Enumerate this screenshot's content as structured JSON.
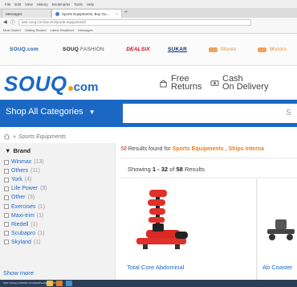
{
  "browser": {
    "menu": [
      "File",
      "Edit",
      "View",
      "History",
      "Bookmarks",
      "Tools",
      "Help"
    ],
    "tabs": [
      {
        "label": "Messages"
      },
      {
        "label": "Sports Equipments, Buy Gu..."
      }
    ],
    "new_tab": "+",
    "url": "uae.souq.com/ae-en/sports-equipments/",
    "bookmarks": [
      "Most Visited",
      "Getting Started",
      "Latest Headlines",
      "Messages"
    ]
  },
  "brand_strip": {
    "souq": "SOUQ.com",
    "fashion_bold": "SOUQ",
    "fashion_thin": "FASHION",
    "deal": "DEALSIX",
    "sukar": "SUKAR",
    "stores": "Stores",
    "motors": "Motors"
  },
  "header": {
    "logo_word": "SOUQ",
    "logo_com": "com",
    "perks": [
      {
        "line1": "Free",
        "line2": "Returns",
        "icon": "return-box-icon"
      },
      {
        "line1": "Cash",
        "line2": "On Delivery",
        "icon": "cash-icon"
      }
    ]
  },
  "search": {
    "category_label": "Shop All Categories",
    "placeholder": "",
    "clip": "S"
  },
  "breadcrumb": {
    "separator": "»",
    "current": "Sports Equipments"
  },
  "sidebar": {
    "heading": "Brand",
    "filters": [
      {
        "label": "Winmax",
        "count": "(13)"
      },
      {
        "label": "Others",
        "count": "(11)"
      },
      {
        "label": "York",
        "count": "(4)"
      },
      {
        "label": "Life Power",
        "count": "(3)"
      },
      {
        "label": "Other",
        "count": "(3)"
      },
      {
        "label": "Exercises",
        "count": "(1)"
      },
      {
        "label": "Maxi-trim",
        "count": "(1)"
      },
      {
        "label": "Riedell",
        "count": "(1)"
      },
      {
        "label": "Scubapro",
        "count": "(1)"
      },
      {
        "label": "Skyland",
        "count": "(1)"
      }
    ],
    "show_more": "Show more"
  },
  "results": {
    "count": "58",
    "found_text": "Results found for",
    "query": "Sports Equipments , Ships Interna",
    "showing_prefix": "Showing",
    "range": "1 - 32",
    "of_text": "of",
    "total": "58",
    "results_word": "Results"
  },
  "products": [
    {
      "name": "Total Core Abdominal",
      "color": "#e0302b"
    },
    {
      "name": "Ab Coaster",
      "color": "#555555"
    }
  ],
  "statusbar": {
    "url": "uae.souq.com/ae-en/sports-equipments/"
  },
  "colors": {
    "brand_blue": "#1b68c4",
    "link_blue": "#1b68c4",
    "highlight_orange": "#e67e22",
    "deal_red": "#d0021b"
  }
}
